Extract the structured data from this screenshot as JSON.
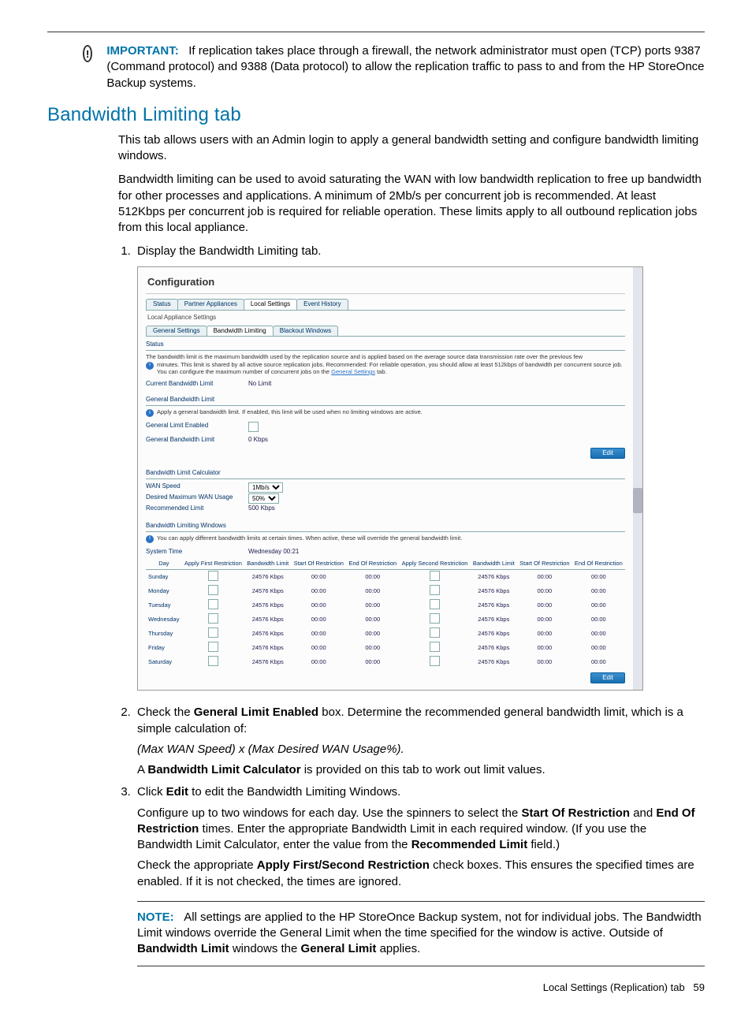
{
  "important_kw": "IMPORTANT:",
  "important_text": "If replication takes place through a firewall, the network administrator must open (TCP) ports 9387 (Command protocol) and 9388 (Data protocol) to allow the replication traffic to pass to and from the HP StoreOnce Backup systems.",
  "h2": "Bandwidth Limiting tab",
  "intro_p1": "This tab allows users with an Admin login to apply a general bandwidth setting and configure bandwidth limiting windows.",
  "intro_p2": "Bandwidth limiting can be used to avoid saturating the WAN with low bandwidth replication to free up bandwidth for other processes and applications. A minimum of 2Mb/s per concurrent job is recommended. At least 512Kbps per concurrent job is required for reliable operation. These limits apply to all outbound replication jobs from this local appliance.",
  "step1": "Display the Bandwidth Limiting tab.",
  "step2_a": "Check the ",
  "step2_b": "General Limit Enabled",
  "step2_c": " box. Determine the recommended general bandwidth limit, which is a simple calculation of:",
  "step2_formula": "(Max WAN Speed) x (Max Desired WAN Usage%).",
  "step2_d_a": "A ",
  "step2_d_b": "Bandwidth Limit Calculator",
  "step2_d_c": " is provided on this tab to work out limit values.",
  "step3_a": "Click ",
  "step3_b": "Edit",
  "step3_c": " to edit the Bandwidth Limiting Windows.",
  "step3_p2_a": "Configure up to two windows for each day. Use the spinners to select the ",
  "step3_p2_b": "Start Of Restriction",
  "step3_p2_c": " and ",
  "step3_p2_d": "End Of Restriction",
  "step3_p2_e": " times. Enter the appropriate Bandwidth Limit in each required window. (If you use the Bandwidth Limit Calculator, enter the value from the ",
  "step3_p2_f": "Recommended Limit",
  "step3_p2_g": " field.)",
  "step3_p3_a": "Check the appropriate ",
  "step3_p3_b": "Apply First/Second Restriction",
  "step3_p3_c": " check boxes. This ensures the specified times are enabled. If it is not checked, the times are ignored.",
  "note_kw": "NOTE:",
  "note_text_a": "All settings are applied to the HP StoreOnce Backup system, not for individual jobs. The Bandwidth Limit windows override the General Limit when the time specified for the window is active. Outside of ",
  "note_text_b": "Bandwidth Limit",
  "note_text_c": " windows the ",
  "note_text_d": "General Limit",
  "note_text_e": " applies.",
  "footer_label": "Local Settings (Replication) tab",
  "footer_page": "59",
  "shot": {
    "title": "Configuration",
    "tabs1": [
      "Status",
      "Partner Appliances",
      "Local Settings",
      "Event History"
    ],
    "tabs1_active": 2,
    "subtitle": "Local Appliance Settings",
    "tabs2": [
      "General Settings",
      "Bandwidth Limiting",
      "Blackout Windows"
    ],
    "tabs2_active": 1,
    "status": "Status",
    "info1_a": "The bandwidth limit is the maximum bandwidth used by the replication source and is applied based on the average source data transmission rate over the previous few",
    "info1_b": "minutes. This limit is shared by all active source replication jobs. Recommended: For reliable operation, you should allow at least 512kbps of bandwidth per concurrent source job. You can configure the maximum number of concurrent jobs on the ",
    "info1_link": "General Settings",
    "info1_c": " tab.",
    "curlimit_lab": "Current Bandwidth Limit",
    "curlimit_val": "No Limit",
    "gblimit_hdr": "General Bandwidth Limit",
    "info2": "Apply a general bandwidth limit. If enabled, this limit will be used when no limiting windows are active.",
    "gle_lab": "General Limit Enabled",
    "gbl_lab": "General Bandwidth Limit",
    "gbl_val": "0 Kbps",
    "edit": "Edit",
    "calc_hdr": "Bandwidth Limit Calculator",
    "wan_lab": "WAN Speed",
    "wan_val": "1Mb/s",
    "usage_lab": "Desired Maximum WAN Usage",
    "usage_val": "50%",
    "rec_lab": "Recommended Limit",
    "rec_val": "500 Kbps",
    "win_hdr": "Bandwidth Limiting Windows",
    "info3": "You can apply different bandwidth limits at certain times. When active, these will override the general bandwidth limit.",
    "time_lab": "System Time",
    "time_val": "Wednesday 00:21",
    "cols": [
      "Day",
      "Apply First Restriction",
      "Bandwidth Limit",
      "Start Of Restriction",
      "End Of Restriction",
      "Apply Second Restriction",
      "Bandwidth Limit",
      "Start Of Restriction",
      "End Of Restriction"
    ],
    "days": [
      "Sunday",
      "Monday",
      "Tuesday",
      "Wednesday",
      "Thursday",
      "Friday",
      "Saturday"
    ],
    "bwlimit": "24576 Kbps",
    "zero": "00:00"
  }
}
